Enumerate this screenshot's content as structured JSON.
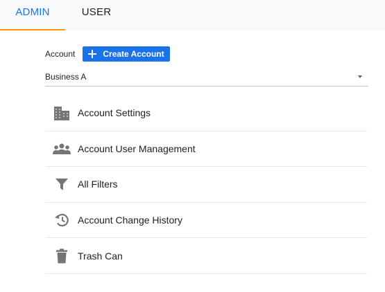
{
  "tabs": {
    "admin": "ADMIN",
    "user": "USER"
  },
  "account": {
    "label": "Account",
    "create_button": "Create Account",
    "selected": "Business A"
  },
  "menu": [
    {
      "label": "Account Settings",
      "icon": "building-icon"
    },
    {
      "label": "Account User Management",
      "icon": "people-icon"
    },
    {
      "label": "All Filters",
      "icon": "filter-icon"
    },
    {
      "label": "Account Change History",
      "icon": "history-icon"
    },
    {
      "label": "Trash Can",
      "icon": "trash-icon"
    }
  ],
  "colors": {
    "active_tab": "#1a73e8",
    "tab_underline": "#ff9800",
    "primary_button": "#1a73e8",
    "icon": "#757575"
  }
}
